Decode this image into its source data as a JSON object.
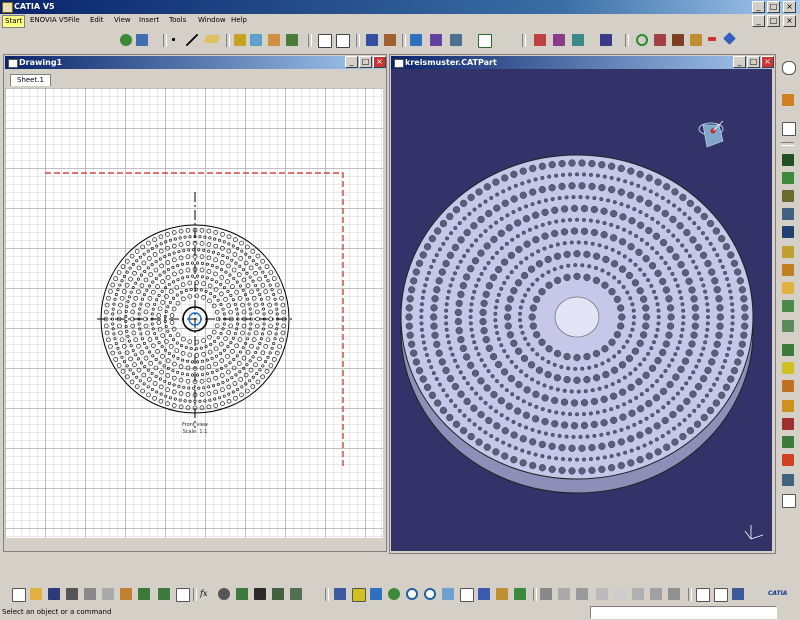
{
  "app": {
    "title": "CATIA V5"
  },
  "menu": [
    "Start",
    "ENOVIA V5",
    "File",
    "Edit",
    "View",
    "Insert",
    "Tools",
    "Window",
    "Help"
  ],
  "drawing_window": {
    "title": "Drawing1",
    "sheet_tab": "Sheet.1",
    "view_label_line1": "Front view",
    "view_label_line2": "Scale: 1:1"
  },
  "part_window": {
    "title": "kreismuster.CATPart"
  },
  "status": {
    "message": "Select an object or a command",
    "command_input": ""
  },
  "colors": {
    "title_bar": "#0a246a",
    "viewer_background": "#33336a",
    "part_face": "#c7c7ea",
    "part_side": "#8e8eb8",
    "hole": "#5e5e7a",
    "frame_line": "#cc2222"
  }
}
